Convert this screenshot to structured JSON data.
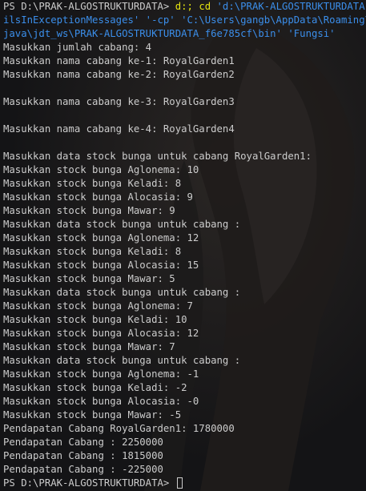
{
  "terminal": {
    "command": {
      "prompt": "PS D:\\PRAK-ALGOSTRUKTURDATA> ",
      "cmd_part1": "d:; cd ",
      "cmd_part2": "'d:\\PRAK-ALGOSTRUKTURDATA';",
      "cmd_line2": "ilsInExceptionMessages' '-cp' 'C:\\Users\\gangb\\AppData\\Roaming\\Cod",
      "cmd_line3": "java\\jdt_ws\\PRAK-ALGOSTRUKTURDATA_f6e785cf\\bin' 'Fungsi'"
    },
    "lines": [
      "Masukkan jumlah cabang: 4",
      "Masukkan nama cabang ke-1: RoyalGarden1",
      "Masukkan nama cabang ke-2: RoyalGarden2",
      "",
      "Masukkan nama cabang ke-3: RoyalGarden3",
      "",
      "Masukkan nama cabang ke-4: RoyalGarden4",
      "",
      "Masukkan data stock bunga untuk cabang RoyalGarden1:",
      "Masukkan stock bunga Aglonema: 10",
      "Masukkan stock bunga Keladi: 8",
      "Masukkan stock bunga Alocasia: 9",
      "Masukkan stock bunga Mawar: 9",
      "Masukkan data stock bunga untuk cabang :",
      "Masukkan stock bunga Aglonema: 12",
      "Masukkan stock bunga Keladi: 8",
      "Masukkan stock bunga Alocasia: 15",
      "Masukkan stock bunga Mawar: 5",
      "Masukkan data stock bunga untuk cabang :",
      "Masukkan stock bunga Aglonema: 7",
      "Masukkan stock bunga Keladi: 10",
      "Masukkan stock bunga Alocasia: 12",
      "Masukkan stock bunga Mawar: 7",
      "Masukkan data stock bunga untuk cabang :",
      "Masukkan stock bunga Aglonema: -1",
      "Masukkan stock bunga Keladi: -2",
      "Masukkan stock bunga Alocasia: -0",
      "Masukkan stock bunga Mawar: -5",
      "Pendapatan Cabang RoyalGarden1: 1780000",
      "Pendapatan Cabang : 2250000",
      "Pendapatan Cabang : 1815000",
      "Pendapatan Cabang : -225000"
    ],
    "final_prompt": "PS D:\\PRAK-ALGOSTRUKTURDATA> "
  },
  "colors": {
    "background": "#141416",
    "text": "#cccccc",
    "command_yellow": "#e5e510",
    "command_blue": "#3b8eea"
  }
}
